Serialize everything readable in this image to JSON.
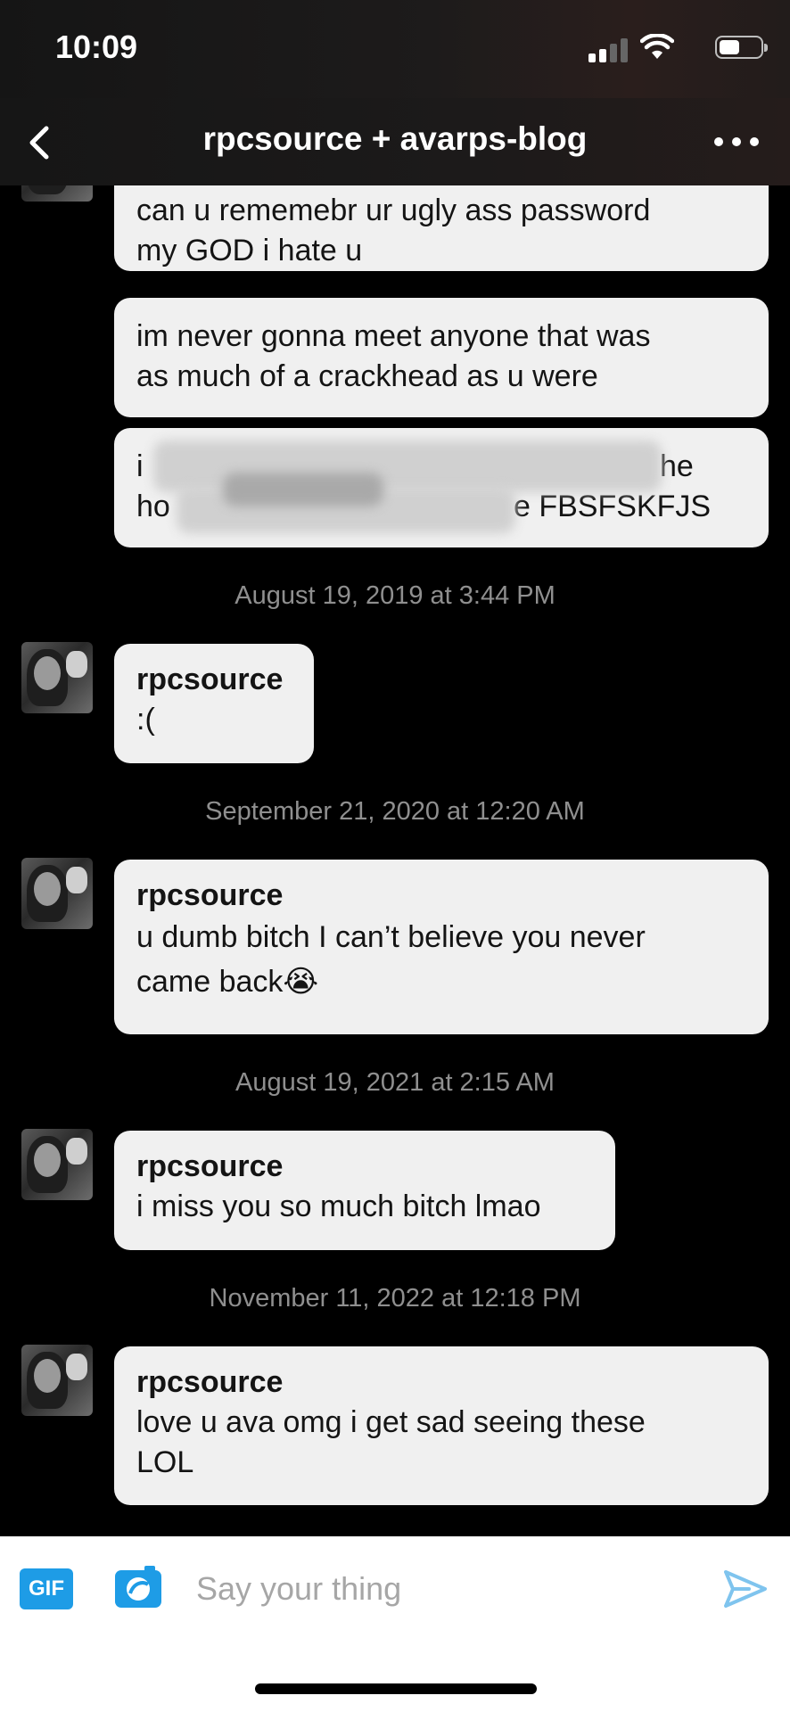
{
  "status_bar": {
    "time": "10:09"
  },
  "header": {
    "title": "rpcsource + avarps-blog"
  },
  "messages": [
    {
      "sender": "",
      "lines": [
        "can u rememebr ur ugly ass password",
        "my GOD i hate u"
      ]
    },
    {
      "sender": "",
      "lines": [
        "im never gonna meet anyone that was",
        "as much of a crackhead as u were"
      ]
    },
    {
      "sender": "",
      "lines": [
        "i",
        "he",
        "ho",
        "e FBSFSKFJS"
      ]
    },
    {
      "timestamp": "August 19, 2019 at 3:44 PM",
      "sender": "rpcsource",
      "lines": [
        ":("
      ]
    },
    {
      "timestamp": "September 21, 2020 at 12:20 AM",
      "sender": "rpcsource",
      "lines": [
        "u dumb bitch I can’t believe you never",
        "came back😭"
      ]
    },
    {
      "timestamp": "August 19, 2021 at 2:15 AM",
      "sender": "rpcsource",
      "lines": [
        "i miss you so much bitch lmao"
      ]
    },
    {
      "timestamp": "November 11, 2022 at 12:18 PM",
      "sender": "rpcsource",
      "lines": [
        "love u ava omg i get sad seeing these",
        "LOL"
      ]
    }
  ],
  "composer": {
    "gif_label": "GIF",
    "placeholder": "Say your thing"
  },
  "colors": {
    "accent": "#1e9ce6",
    "bubble": "#f0f0f0",
    "background": "#000000"
  }
}
